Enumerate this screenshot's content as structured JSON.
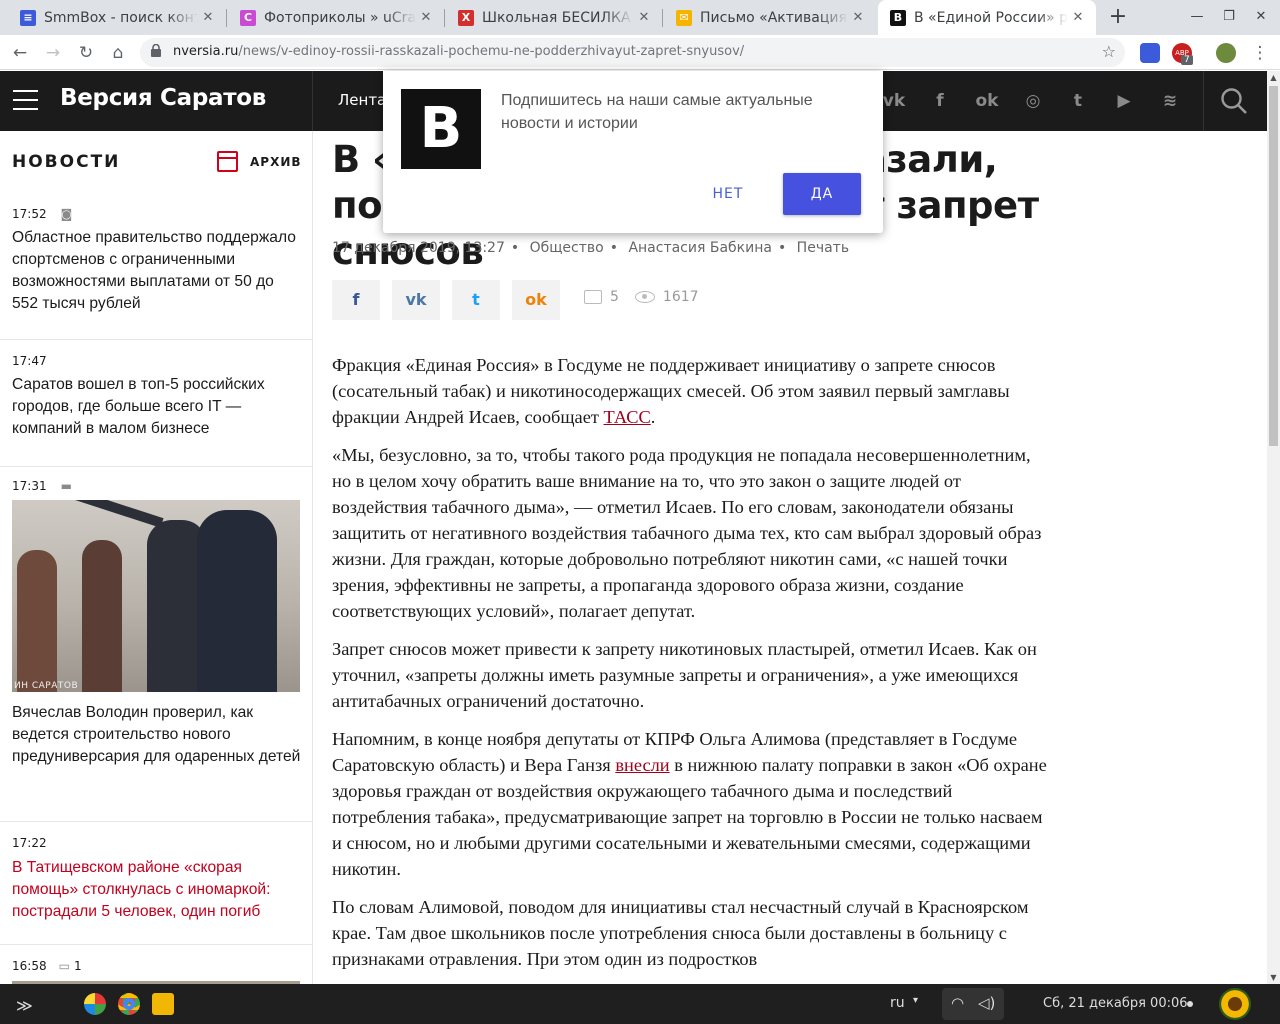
{
  "browser": {
    "tabs": [
      {
        "title": "SmmBox - поиск конте",
        "favicon_color": "#3b5bdb",
        "favicon_glyph": "layers-icon"
      },
      {
        "title": "Фотоприколы » uCrazy",
        "favicon_color": "#c94bd3",
        "favicon_glyph": "C"
      },
      {
        "title": "Школьная БЕСИЛКА",
        "favicon_color": "#d32f2f",
        "favicon_glyph": "X"
      },
      {
        "title": "Письмо «Активация п",
        "favicon_color": "#f4b400",
        "favicon_glyph": "mail-icon"
      },
      {
        "title": "В «Единой России» р",
        "favicon_color": "#111111",
        "favicon_glyph": "B"
      }
    ],
    "active_tab_index": 4,
    "url_domain": "nversia.ru",
    "url_path": "/news/v-edinoy-rossii-rasskazali-pochemu-ne-podderzhivayut-zapret-snyusov/",
    "extension_badge": "7",
    "extension_label": "ABP"
  },
  "site": {
    "title": "Версия Саратов",
    "nav_first": "Лента",
    "social_icons": [
      "vk-icon",
      "facebook-icon",
      "odnoklassniki-icon",
      "instagram-icon",
      "twitter-icon",
      "youtube-icon",
      "rss-icon"
    ]
  },
  "sidebar": {
    "heading": "НОВОСТИ",
    "archive_label": "АРХИВ",
    "news": [
      {
        "time": "17:52",
        "icon": "camera-icon",
        "text": "Областное правительство поддержало спортсменов с ограниченными возможностями выплатами от 50 до 552 тысяч рублей",
        "highlight": false
      },
      {
        "time": "17:47",
        "icon": "",
        "text": "Саратов вошел в топ-5 российских городов, где больше всего IT — компаний в малом бизнесе",
        "highlight": false
      },
      {
        "time": "17:31",
        "icon": "video-icon",
        "text": "Вячеслав Володин проверил, как ведется строительство нового предуниверсария для одаренных детей",
        "highlight": false,
        "photo_watermark": "ИН САРАТОВ"
      },
      {
        "time": "17:22",
        "icon": "",
        "text": "В Татищевском районе «скорая помощь» столкнулась с иномаркой: пострадали 5 человек, один погиб",
        "highlight": true
      },
      {
        "time": "16:58",
        "icon": "comment-icon",
        "comments": "1",
        "text": "",
        "highlight": false
      }
    ]
  },
  "article": {
    "headline": "В «Единой России» рассказали, почему не поддерживают запрет снюсов",
    "date": "17 декабря 2019, 13:27",
    "category": "Общество",
    "author": "Анастасия Бабкина",
    "print_label": "Печать",
    "comments_count": "5",
    "views_count": "1617",
    "share_buttons": [
      "facebook-share",
      "vk-share",
      "twitter-share",
      "odnoklassniki-share"
    ],
    "paragraphs": [
      {
        "before": "Фракция «Единая Россия» в Госдуме не поддерживает инициативу о запрете снюсов (сосательный табак) и никотиносодержащих смесей. Об этом заявил первый замглавы фракции Андрей Исаев, сообщает ",
        "link": "ТАСС",
        "after": "."
      },
      {
        "before": "«Мы, безусловно, за то, чтобы такого рода продукция не попадала несовершеннолетним, но в целом хочу обратить ваше внимание на то, что это закон о защите людей от воздействия табачного дыма», — отметил Исаев. По его словам, законодатели обязаны защитить от негативного воздействия табачного дыма тех, кто сам выбрал здоровый образ жизни. Для граждан, которые добровольно потребляют никотин сами, «с нашей точки зрения, эффективны не запреты, а пропаганда здорового образа жизни, создание соответствующих условий», полагает депутат.",
        "link": "",
        "after": ""
      },
      {
        "before": "Запрет снюсов может привести к запрету никотиновых пластырей, отметил Исаев. Как он уточнил, «запреты должны иметь разумные запреты и ограничения», а уже имеющихся антитабачных ограничений достаточно.",
        "link": "",
        "after": ""
      },
      {
        "before": "Напомним, в конце ноября депутаты от КПРФ Ольга Алимова (представляет в Госдуме Саратовскую область) и Вера Ганзя ",
        "link": "внесли",
        "after": " в нижнюю палату поправки в закон «Об охране здоровья граждан от воздействия окружающего табачного дыма и последствий потребления табака», предусматривающие запрет на торговлю в России не только насваем и снюсом, но и любыми другими сосательными и жевательными смесями, содержащими никотин."
      },
      {
        "before": "По словам Алимовой, поводом для инициативы стал несчастный случай в Красноярском крае. Там двое школьников после употребления снюса были доставлены в больницу с признаками отравления. При этом один из подростков",
        "link": "",
        "after": ""
      }
    ]
  },
  "popup": {
    "logo_letter": "B",
    "message": "Подпишитесь на наши самые актуальные новости и истории",
    "no_label": "НЕТ",
    "yes_label": "ДА"
  },
  "taskbar": {
    "lang": "ru",
    "clock": "Сб, 21 декабря  00:06"
  },
  "colors": {
    "site_header": "#1b1b1b",
    "accent_red": "#c4001d",
    "popup_button": "#4651e0"
  }
}
